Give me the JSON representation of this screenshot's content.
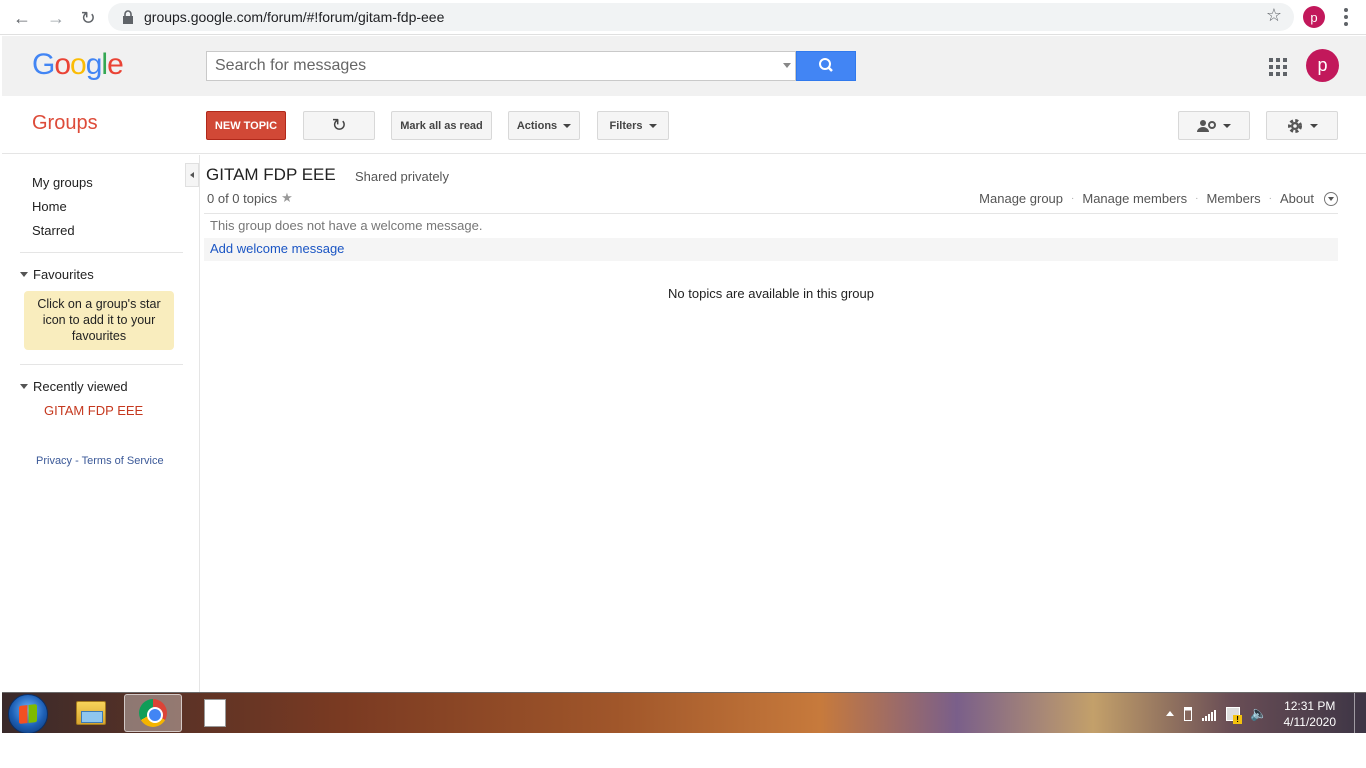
{
  "browser": {
    "url": "groups.google.com/forum/#!forum/gitam-fdp-eee",
    "profile_initial": "p"
  },
  "header": {
    "logo_text": "Google",
    "search_placeholder": "Search for messages",
    "account_initial": "p"
  },
  "toolbar": {
    "app_title": "Groups",
    "new_topic_label": "NEW TOPIC",
    "mark_read_label": "Mark all as read",
    "actions_label": "Actions",
    "filters_label": "Filters"
  },
  "sidebar": {
    "links": [
      "My groups",
      "Home",
      "Starred"
    ],
    "favourites_heading": "Favourites",
    "favourites_note": "Click on a group's star icon to add it to your favourites",
    "recent_heading": "Recently viewed",
    "recent_groups": [
      "GITAM FDP EEE"
    ],
    "footer_privacy": "Privacy",
    "footer_sep": "-",
    "footer_terms": "Terms of Service"
  },
  "main": {
    "group_name": "GITAM FDP EEE",
    "privacy": "Shared privately",
    "topic_count": "0 of 0 topics",
    "group_links": [
      "Manage group",
      "Manage members",
      "Members",
      "About"
    ],
    "welcome_text": "This group does not have a welcome message.",
    "add_welcome_label": "Add welcome message",
    "empty_text": "No topics are available in this group"
  },
  "taskbar": {
    "time": "12:31 PM",
    "date": "4/11/2020"
  },
  "colors": {
    "accent_red": "#dd4b39",
    "new_topic_bg": "#d14836",
    "search_blue": "#4285f4",
    "avatar_pink": "#c2185b",
    "link_blue": "#1a55c4"
  }
}
